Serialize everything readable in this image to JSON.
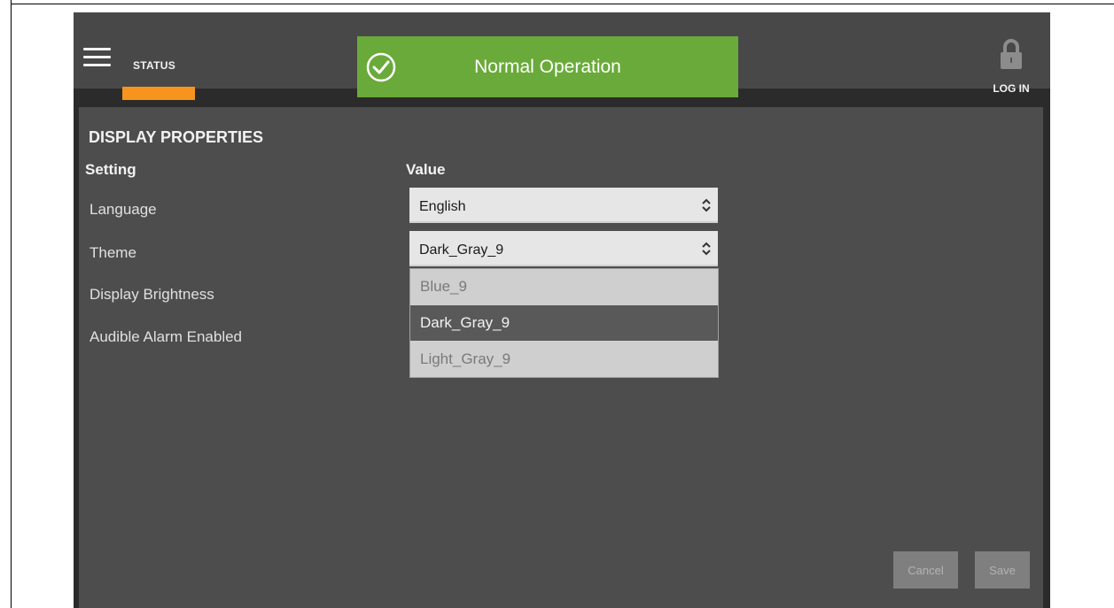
{
  "header": {
    "nav_label": "STATUS",
    "banner_text": "Normal Operation",
    "login_label": "LOG IN"
  },
  "panel": {
    "title": "DISPLAY PROPERTIES",
    "col_setting": "Setting",
    "col_value": "Value",
    "rows": [
      {
        "label": "Language",
        "value": "English"
      },
      {
        "label": "Theme",
        "value": "Dark_Gray_9"
      },
      {
        "label": "Display Brightness"
      },
      {
        "label": "Audible Alarm Enabled"
      }
    ],
    "theme_options": [
      "Blue_9",
      "Dark_Gray_9",
      "Light_Gray_9"
    ]
  },
  "buttons": {
    "cancel": "Cancel",
    "save": "Save"
  },
  "colors": {
    "accent": "#f7941d",
    "banner": "#6aaa3a"
  }
}
